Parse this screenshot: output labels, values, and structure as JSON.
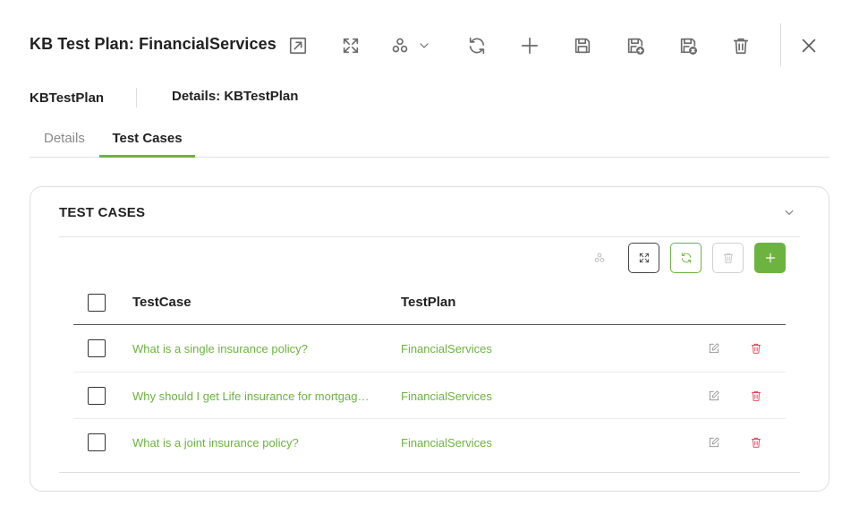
{
  "header": {
    "title": "KB Test Plan: FinancialServices",
    "toolbar_icons": [
      "open-external-icon",
      "expand-icon",
      "group-icon",
      "chevron-down-icon",
      "refresh-icon",
      "add-icon",
      "save-icon",
      "save-new-icon",
      "save-close-icon",
      "trash-icon",
      "close-icon"
    ]
  },
  "subheader": {
    "name": "KBTestPlan",
    "details": "Details: KBTestPlan"
  },
  "tabs": [
    {
      "label": "Details",
      "active": false
    },
    {
      "label": "Test Cases",
      "active": true
    }
  ],
  "panel": {
    "title": "TEST CASES",
    "columns": [
      "TestCase",
      "TestPlan"
    ],
    "rows": [
      {
        "testcase": "What is a single insurance policy?",
        "testplan": "FinancialServices"
      },
      {
        "testcase": "Why should I get Life insurance for mortgage…",
        "testplan": "FinancialServices"
      },
      {
        "testcase": "What is a joint insurance policy?",
        "testplan": "FinancialServices"
      }
    ]
  },
  "colors": {
    "accent": "#6cb33f",
    "delete": "#e0344f",
    "text": "#222222",
    "muted": "#8a8a8a"
  }
}
